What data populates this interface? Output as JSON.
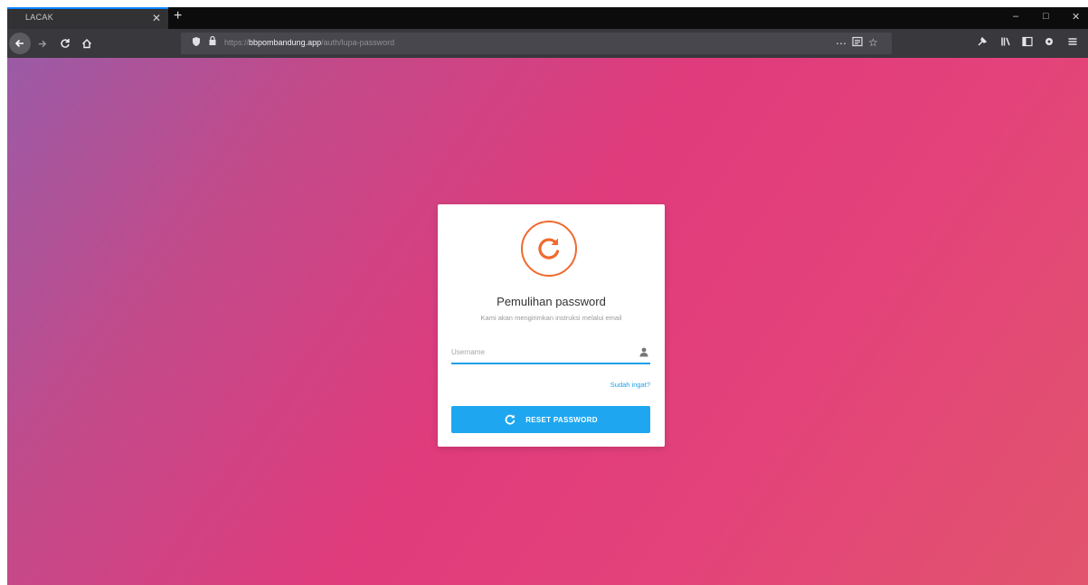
{
  "browser": {
    "tab_title": "LACAK",
    "tab_close": "✕",
    "new_tab": "+",
    "window_controls": {
      "minimize": "–",
      "maximize": "□",
      "close": "✕"
    },
    "nav_icons": [
      "back-icon",
      "forward-icon",
      "reload-icon",
      "home-icon"
    ],
    "url": {
      "prefix": "https://",
      "domain": "bbpombandung.app",
      "path": "/auth/lupa-password"
    },
    "toolbar_icons": [
      "pin-icon",
      "library-icon",
      "sidebar-icon",
      "extension-icon",
      "menu-icon"
    ]
  },
  "card": {
    "title": "Pemulihan password",
    "subtitle": "Kami akan mengirimkan instruksi melalui email",
    "username_placeholder": "Username",
    "forgot_link": "Sudah ingat?",
    "reset_button": "RESET PASSWORD"
  },
  "colors": {
    "accent": "#1ea7f0",
    "logo": "#f06a2e",
    "background_start": "#9b5ba6",
    "background_end": "#e2546d"
  }
}
